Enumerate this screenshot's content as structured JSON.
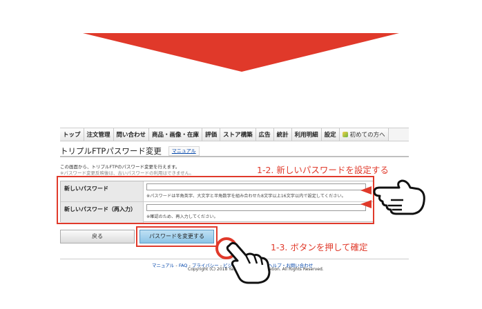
{
  "nav": {
    "items": [
      "トップ",
      "注文管理",
      "問い合わせ",
      "商品・画像・在庫",
      "評価",
      "ストア構築",
      "広告",
      "統計",
      "利用明細",
      "設定"
    ],
    "first_timer": "初めての方へ"
  },
  "page": {
    "title": "トリプルFTPパスワード変更",
    "manual_link": "マニュアル",
    "intro_line1": "この画面から、トリプルFTPのパスワード変更を行えます。",
    "intro_line2": "※パスワード変更反映後は、古いパスワードの利用はできません。"
  },
  "form": {
    "new_password_label": "新しいパスワード",
    "new_password_note": "※パスワードは半角英字、大文字と半角数字を組み合わせた8文字以上16文字以内で設定してください。",
    "confirm_password_label": "新しいパスワード（再入力）",
    "confirm_password_note": "※確認のため、再入力してください。"
  },
  "buttons": {
    "back": "戻る",
    "submit": "パスワードを変更する"
  },
  "annotations": {
    "step_2": "1-2. 新しいパスワードを設定する",
    "step_3": "1-3. ボタンを押して確定"
  },
  "footer": {
    "links": [
      "マニュアル",
      "FAQ",
      "プライバシー",
      "ビジネスお利用規約",
      "ヘルプ・お問い合わせ"
    ],
    "copyright": "Copyright (C) 2018 Yahoo Japan Corporation. All Rights Reserved."
  },
  "colors": {
    "annotation_red": "#e0392a",
    "submit_blue": "#8cc4e6"
  }
}
